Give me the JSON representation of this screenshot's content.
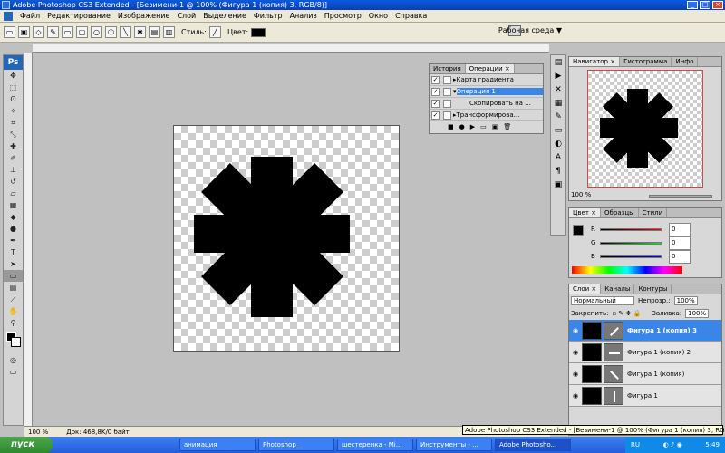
{
  "window": {
    "title": "Adobe Photoshop CS3 Extended - [Безимени-1 @ 100% (Фигура 1 (копия) 3, RGB/8)]"
  },
  "menu": [
    "Файл",
    "Редактирование",
    "Изображение",
    "Слой",
    "Выделение",
    "Фильтр",
    "Анализ",
    "Просмотр",
    "Окно",
    "Справка"
  ],
  "options": {
    "styles_label": "Стиль:",
    "color_label": "Цвет:",
    "workspace": "Рабочая среда ▼"
  },
  "colors": {
    "accent": "#3a85e8",
    "titlebar": "#0a3fb0",
    "foreground": "#000000"
  },
  "actions_panel": {
    "tabs": [
      "История",
      "Операции ×"
    ],
    "rows": [
      {
        "label": "Карта градиента",
        "checked": true
      },
      {
        "label": "Операция 1",
        "checked": true,
        "selected": true
      },
      {
        "label": "Скопировать на ...",
        "checked": true
      },
      {
        "label": "Трансформирова...",
        "checked": true
      }
    ]
  },
  "navigator": {
    "tabs": [
      "Навигатор ×",
      "Гистограмма",
      "Инфо"
    ],
    "zoom": "100 %"
  },
  "color_panel": {
    "tabs": [
      "Цвет ×",
      "Образцы",
      "Стили"
    ],
    "r_label": "R",
    "g_label": "G",
    "b_label": "B",
    "r": "0",
    "g": "0",
    "b": "0"
  },
  "layers_panel": {
    "tabs": [
      "Слои ×",
      "Каналы",
      "Контуры"
    ],
    "blend_mode": "Нормальный",
    "opacity_label": "Непрозр.:",
    "opacity": "100%",
    "lock_label": "Закрепить:",
    "fill_label": "Заливка:",
    "fill": "100%",
    "layers": [
      {
        "name": "Фигура 1 (копия) 3",
        "selected": true
      },
      {
        "name": "Фигура 1 (копия) 2",
        "selected": false
      },
      {
        "name": "Фигура 1 (копия)",
        "selected": false
      },
      {
        "name": "Фигура 1",
        "selected": false
      }
    ]
  },
  "status": {
    "zoom": "100 %",
    "doc": "Док: 468,8K/0 байт"
  },
  "tooltip": "Adobe Photoshop CS3 Extended - [Безимени-1 @ 100% (Фигура 1 (копия) 3, RGB/8)]",
  "taskbar": {
    "start": "пуск",
    "tasks": [
      "анимация",
      "Photoshop_",
      "шестеренка - Mi...",
      "Инструменты - ...",
      "Adobe Photosho..."
    ],
    "lang": "RU",
    "clock": "5:49"
  }
}
